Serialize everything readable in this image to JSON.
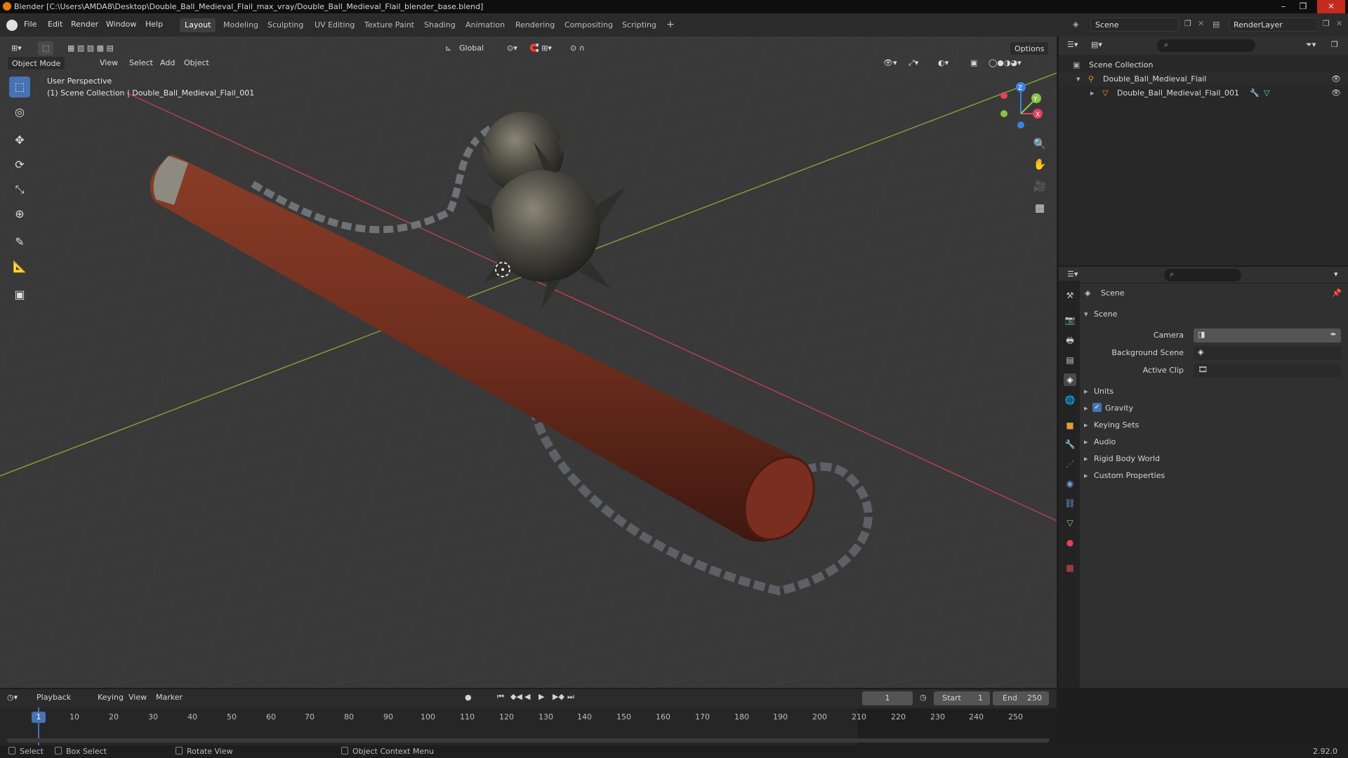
{
  "window": {
    "title": "Blender [C:\\Users\\AMDA8\\Desktop\\Double_Ball_Medieval_Flail_max_vray/Double_Ball_Medieval_Flail_blender_base.blend]",
    "minimize": "–",
    "maximize": "❐",
    "close": "✕"
  },
  "menu": [
    "File",
    "Edit",
    "Render",
    "Window",
    "Help"
  ],
  "workspaces": [
    {
      "label": "Layout",
      "active": true
    },
    {
      "label": "Modeling"
    },
    {
      "label": "Sculpting"
    },
    {
      "label": "UV Editing"
    },
    {
      "label": "Texture Paint"
    },
    {
      "label": "Shading"
    },
    {
      "label": "Animation"
    },
    {
      "label": "Rendering"
    },
    {
      "label": "Compositing"
    },
    {
      "label": "Scripting"
    }
  ],
  "add_workspace": "+",
  "scene_selector": {
    "value": "Scene"
  },
  "view_layer": {
    "value": "RenderLayer"
  },
  "viewport": {
    "mode": "Object Mode",
    "menus": [
      "View",
      "Select",
      "Add",
      "Object"
    ],
    "transform_orientation": "Global",
    "options_label": "Options",
    "overlay_line1": "User Perspective",
    "overlay_line2": "(1) Scene Collection | Double_Ball_Medieval_Flail_001",
    "axis_labels": {
      "x": "X",
      "y": "Y",
      "z": "Z"
    }
  },
  "tools": [
    {
      "name": "select-box-tool",
      "glyph": "⬚",
      "active": true
    },
    {
      "name": "cursor-tool",
      "glyph": "◎"
    },
    {
      "name": "move-tool",
      "glyph": "✥"
    },
    {
      "name": "rotate-tool",
      "glyph": "⟳"
    },
    {
      "name": "scale-tool",
      "glyph": "⤡"
    },
    {
      "name": "transform-tool",
      "glyph": "⊕"
    },
    {
      "name": "annotate-tool",
      "glyph": "✎"
    },
    {
      "name": "measure-tool",
      "glyph": "📐"
    },
    {
      "name": "add-cube-tool",
      "glyph": "▣"
    }
  ],
  "outliner": {
    "root": "Scene Collection",
    "items": [
      {
        "label": "Double_Ball_Medieval_Flail",
        "level": 1
      },
      {
        "label": "Double_Ball_Medieval_Flail_001",
        "level": 2
      }
    ]
  },
  "properties": {
    "context": "Scene",
    "panel": "Scene",
    "camera_label": "Camera",
    "background_scene_label": "Background Scene",
    "active_clip_label": "Active Clip",
    "sections": [
      "Units",
      "Gravity",
      "Keying Sets",
      "Audio",
      "Rigid Body World",
      "Custom Properties"
    ],
    "gravity_checked": true
  },
  "timeline": {
    "menus": [
      "Playback",
      "Keying",
      "View",
      "Marker"
    ],
    "current_frame": "1",
    "start_label": "Start",
    "start": "1",
    "end_label": "End",
    "end": "250",
    "ticks": [
      "1",
      "10",
      "20",
      "30",
      "40",
      "50",
      "60",
      "70",
      "80",
      "90",
      "100",
      "110",
      "120",
      "130",
      "140",
      "150",
      "160",
      "170",
      "180",
      "190",
      "200",
      "210",
      "220",
      "230",
      "240",
      "250"
    ]
  },
  "statusbar": {
    "select": "Select",
    "box_select": "Box Select",
    "rotate_view": "Rotate View",
    "context_menu": "Object Context Menu",
    "version": "2.92.0"
  },
  "colors": {
    "accent": "#4772b3",
    "x_axis": "#e0445c",
    "y_axis": "#8bc34a",
    "z_axis": "#3d84e0",
    "wood": "#6e2e1e"
  }
}
